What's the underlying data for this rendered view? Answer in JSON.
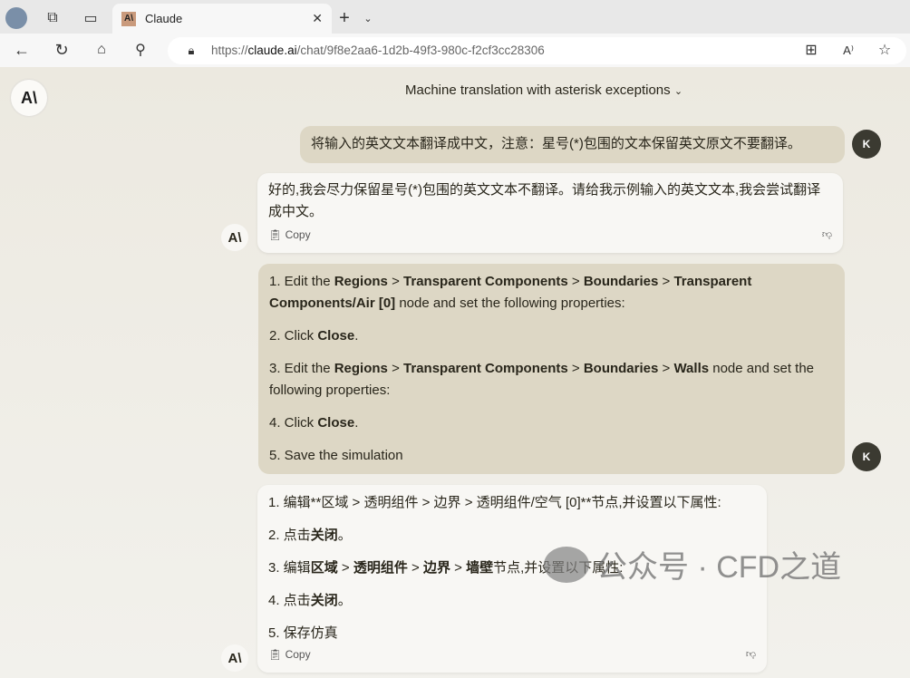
{
  "browser": {
    "tab_title": "Claude",
    "url_prefix": "https://",
    "url_host": "claude.ai",
    "url_path": "/chat/9f8e2aa6-1d2b-49f3-980c-f2cf3cc28306"
  },
  "chat": {
    "title": "Machine translation with asterisk exceptions",
    "user_initial": "K",
    "claude_logo": "A\\",
    "messages": [
      {
        "role": "user",
        "text": "将输入的英文文本翻译成中文，注意：星号(*)包围的文本保留英文原文不要翻译。"
      },
      {
        "role": "assistant",
        "text": "好的,我会尽力保留星号(*)包围的英文文本不翻译。请给我示例输入的英文文本,我会尝试翻译成中文。",
        "copy": "Copy"
      },
      {
        "role": "user",
        "lines": [
          "1. Edit the <b>Regions</b> &gt; <b>Transparent Components</b> &gt; <b>Boundaries</b> &gt; <b>Transparent Components/Air [0]</b> node and set the following properties:",
          "2. Click <b>Close</b>.",
          "3. Edit the <b>Regions</b> &gt; <b>Transparent Components</b> &gt; <b>Boundaries</b> &gt; <b>Walls</b> node and set the following properties:",
          "4. Click <b>Close</b>.",
          "5. Save the simulation"
        ]
      },
      {
        "role": "assistant",
        "lines": [
          "1. 编辑**区域 &gt; 透明组件 &gt; 边界 &gt; 透明组件/空气 [0]**节点,并设置以下属性:",
          "2. 点击<b>关闭</b>。",
          "3. 编辑<b>区域</b> &gt; <b>透明组件</b> &gt; <b>边界</b> &gt; <b>墙壁</b>节点,并设置以下属性:",
          "4. 点击<b>关闭</b>。",
          "5. 保存仿真"
        ],
        "copy": "Copy"
      }
    ]
  },
  "watermark": "公众号 · CFD之道"
}
